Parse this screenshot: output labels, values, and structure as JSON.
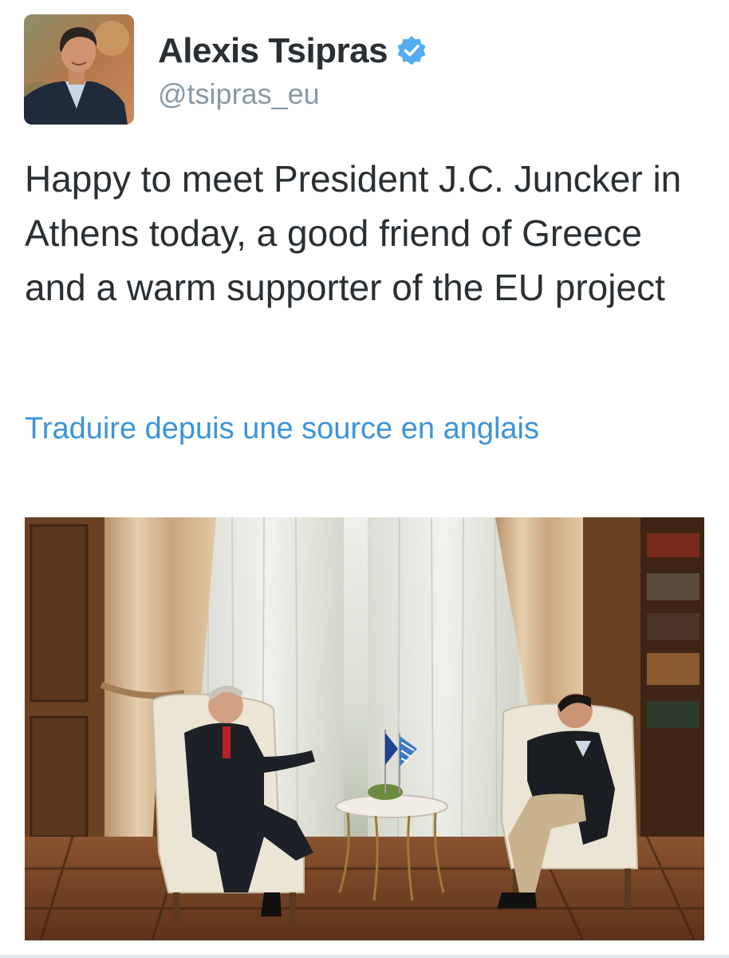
{
  "author": {
    "display_name": "Alexis Tsipras",
    "handle": "@tsipras_eu",
    "verified": true
  },
  "tweet": {
    "text": "Happy to meet President J.C. Juncker in Athens today, a good friend of Greece and a warm supporter of the EU project"
  },
  "translate": {
    "label": "Traduire depuis une source en anglais"
  },
  "colors": {
    "link": "#3b94d9",
    "handle": "#8899a6",
    "text": "#292f33",
    "verified": "#55acee"
  },
  "icons": {
    "verified": "verified-badge-icon"
  }
}
